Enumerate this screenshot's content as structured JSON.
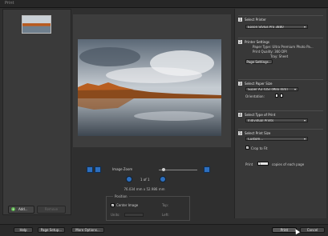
{
  "window": {
    "title": "Print"
  },
  "left_panel": {
    "add_label": "Add...",
    "remove_label": "Remove"
  },
  "preview": {
    "zoom_label": "Image Zoom",
    "zoom_level": 0.2,
    "page_indicator": "1 of 1",
    "image_size": "76.034 mm x 52.986 mm",
    "position": {
      "legend": "Position",
      "center_image_label": "Center Image",
      "center_image_checked": true,
      "top_label": "Top:",
      "units_label": "Units:",
      "left_label": "Left:"
    }
  },
  "settings": {
    "s1": {
      "num": "1",
      "title": "Select Printer",
      "printer": "Epson Stylus Pro 3880"
    },
    "s2": {
      "num": "2",
      "title": "Printer Settings",
      "paper_type": "Paper Type: Ultra Premium Photo Pa...",
      "print_quality": "Print Quality: 360 DPI",
      "tray": "Tray: Sheet",
      "button": "Page Settings..."
    },
    "s3": {
      "num": "3",
      "title": "Select Paper Size",
      "size": "Super A3 (US) (Mini mm)",
      "orientation_label": "Orientation:"
    },
    "s4": {
      "num": "4",
      "title": "Select Type of Print",
      "type": "Individual Prints"
    },
    "s5": {
      "num": "5",
      "title": "Select Print Size",
      "size": "Custom...",
      "crop_label": "Crop to Fit",
      "crop_checked": true,
      "print_label": "Print",
      "copies_label": "copies of each page",
      "copies_value": "1"
    }
  },
  "footer": {
    "help": "Help",
    "page_setup": "Page Setup...",
    "more_options": "More Options...",
    "print": "Print",
    "cancel": "Cancel"
  },
  "colors": {
    "accent": "#2d6fbf",
    "panel": "#383838",
    "background": "#2f2f2f"
  }
}
